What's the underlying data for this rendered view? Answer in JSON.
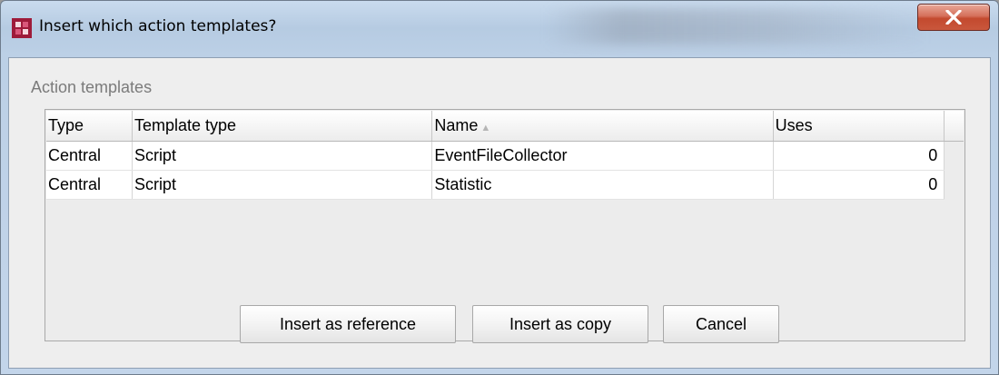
{
  "window": {
    "title": "Insert which action templates?",
    "icon": "app-logo-icon",
    "close_icon": "close-icon",
    "accent_colors": {
      "close_button": "#c9573c",
      "app_icon": "#9e1b3a",
      "title_bar": "#c9dbee"
    }
  },
  "section": {
    "label": "Action templates"
  },
  "table": {
    "columns": [
      "Type",
      "Template type",
      "Name",
      "Uses"
    ],
    "sort_indicator": "▲",
    "rows": [
      {
        "type": "Central",
        "template_type": "Script",
        "name": "EventFileCollector",
        "uses": "0"
      },
      {
        "type": "Central",
        "template_type": "Script",
        "name": "Statistic",
        "uses": "0"
      }
    ]
  },
  "buttons": {
    "insert_reference": "Insert as reference",
    "insert_copy": "Insert as copy",
    "cancel": "Cancel"
  }
}
